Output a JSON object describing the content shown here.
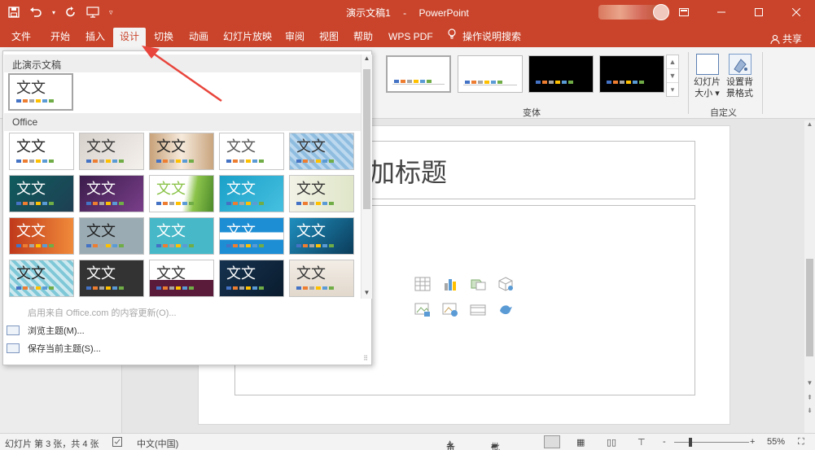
{
  "titlebar": {
    "document_name": "演示文稿1",
    "separator": "-",
    "app_name": "PowerPoint",
    "qat_icons": [
      "save-icon",
      "undo-icon",
      "redo-icon",
      "present-from-start-icon",
      "customize-qat-icon"
    ],
    "window_buttons": [
      "ribbon-display-options-icon",
      "minimize-icon",
      "maximize-icon",
      "close-icon"
    ]
  },
  "tabs": [
    {
      "label": "文件",
      "id": "file"
    },
    {
      "label": "开始",
      "id": "home"
    },
    {
      "label": "插入",
      "id": "insert"
    },
    {
      "label": "设计",
      "id": "design",
      "active": true
    },
    {
      "label": "切换",
      "id": "transitions"
    },
    {
      "label": "动画",
      "id": "animations"
    },
    {
      "label": "幻灯片放映",
      "id": "slideshow"
    },
    {
      "label": "审阅",
      "id": "review"
    },
    {
      "label": "视图",
      "id": "view"
    },
    {
      "label": "帮助",
      "id": "help"
    },
    {
      "label": "WPS PDF",
      "id": "wpspdf"
    },
    {
      "label": "操作说明搜索",
      "id": "tellme"
    }
  ],
  "share_label": "共享",
  "ribbon": {
    "variants_group_label": "变体",
    "customize_group_label": "自定义",
    "slide_size_label_1": "幻灯片",
    "slide_size_label_2": "大小",
    "format_bg_label_1": "设置背",
    "format_bg_label_2": "景格式",
    "variants": [
      {
        "bg": "#ffffff",
        "selected": true
      },
      {
        "bg": "#ffffff",
        "selected": false
      },
      {
        "bg": "#000000",
        "selected": false
      },
      {
        "bg": "#000000",
        "selected": false
      }
    ],
    "palette": [
      "#4472c4",
      "#ed7d31",
      "#a5a5a5",
      "#ffc000",
      "#5b9bd5",
      "#70ad47"
    ]
  },
  "dropdown": {
    "this_presentation_header": "此演示文稿",
    "office_header": "Office",
    "theme_text": "文文",
    "enable_updates": "启用来自 Office.com 的内容更新(O)...",
    "browse_themes": "浏览主题(M)...",
    "save_theme": "保存当前主题(S)..."
  },
  "slide": {
    "title_placeholder": "加标题"
  },
  "statusbar": {
    "slide_info": "幻灯片 第 3 张，共 4 张",
    "language": "中文(中国)",
    "notes_label": "备注",
    "comments_label": "批注",
    "zoom_minus": "-",
    "zoom_plus": "+",
    "zoom_level": "55%"
  },
  "colors": {
    "accent": "#c9442b",
    "arrow": "#e8453c"
  }
}
